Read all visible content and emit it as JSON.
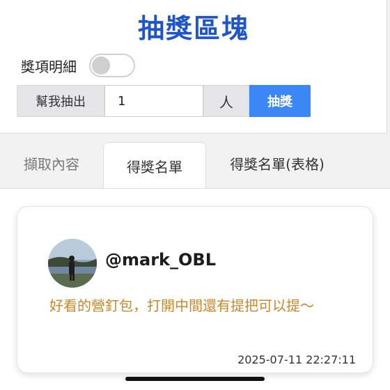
{
  "header": {
    "title": "抽獎區塊"
  },
  "detail": {
    "label": "獎項明細",
    "toggle_on": false
  },
  "draw": {
    "prefix_label": "幫我抽出",
    "count_value": "1",
    "suffix_label": "人",
    "button_label": "抽獎"
  },
  "tabs": [
    {
      "label": "擷取內容",
      "active": false
    },
    {
      "label": "得獎名單",
      "active": true
    },
    {
      "label": "得獎名單(表格)",
      "active": false
    }
  ],
  "winner": {
    "username": "@mark_OBL",
    "comment": "好看的營釘包，打開中間還有提把可以提～",
    "timestamp": "2025-07-11 22:27:11"
  },
  "colors": {
    "title": "#1f55c9",
    "button": "#3a87f5",
    "comment": "#c8882a"
  }
}
